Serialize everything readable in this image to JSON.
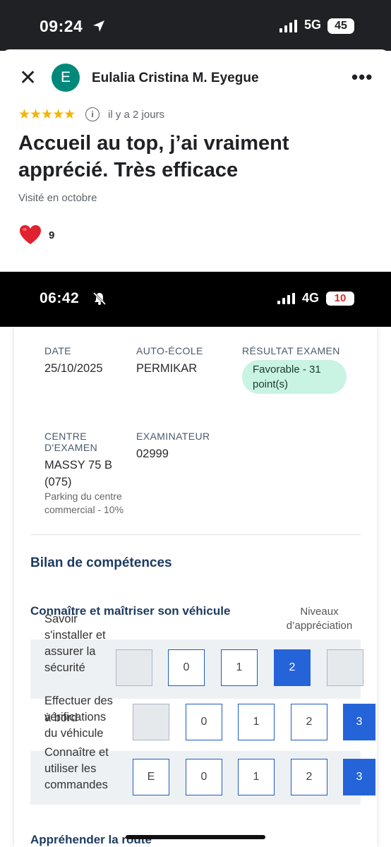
{
  "status_bar_1": {
    "time": "09:24",
    "network": "5G",
    "battery": "45"
  },
  "review": {
    "avatar_letter": "E",
    "reviewer_name": "Eulalia Cristina M. Eyegue",
    "stars": "★★★★★",
    "info_glyph": "i",
    "time_ago": "il y a 2 jours",
    "title": "Accueil au top, j’ai vraiment apprécié. Très efficace",
    "visited": "Visité en octobre",
    "likes": "9",
    "close_glyph": "✕",
    "more_glyph": "•••"
  },
  "status_bar_2": {
    "time": "06:42",
    "network": "4G",
    "battery": "10"
  },
  "exam": {
    "date_label": "DATE",
    "date_value": "25/10/2025",
    "school_label": "AUTO-ÉCOLE",
    "school_value": "PERMIKAR",
    "result_label": "RÉSULTAT EXAMEN",
    "result_value": "Favorable - 31 point(s)",
    "center_label": "CENTRE D'EXAMEN",
    "center_value": "MASSY 75 B (075)",
    "center_detail": "Parking du centre commercial - 10%",
    "examiner_label": "EXAMINATEUR",
    "examiner_value": "02999"
  },
  "skills": {
    "heading": "Bilan de compétences",
    "section1": "Connaître et maîtriser son véhicule",
    "levels_label": "Niveaux d’appréciation",
    "rows": [
      {
        "label": "Savoir s'installer et assurer la sécurité",
        "cells": [
          "",
          "0",
          "1",
          "2",
          ""
        ],
        "selected": "2"
      },
      {
        "label": "Effectuer des vérifications du véhicule",
        "cells": [
          "",
          "0",
          "1",
          "2",
          "3"
        ],
        "selected": "3"
      },
      {
        "label": "Connaître et utiliser les commandes",
        "cells": [
          "E",
          "0",
          "1",
          "2",
          "3"
        ],
        "selected": "3"
      }
    ],
    "row2_overlap_text": "à bord",
    "section2": "Appréhender la route"
  },
  "colors": {
    "accent_blue": "#2563d9",
    "star": "#f4b400",
    "avatar": "#00897b",
    "pill": "#c9f3e3"
  }
}
